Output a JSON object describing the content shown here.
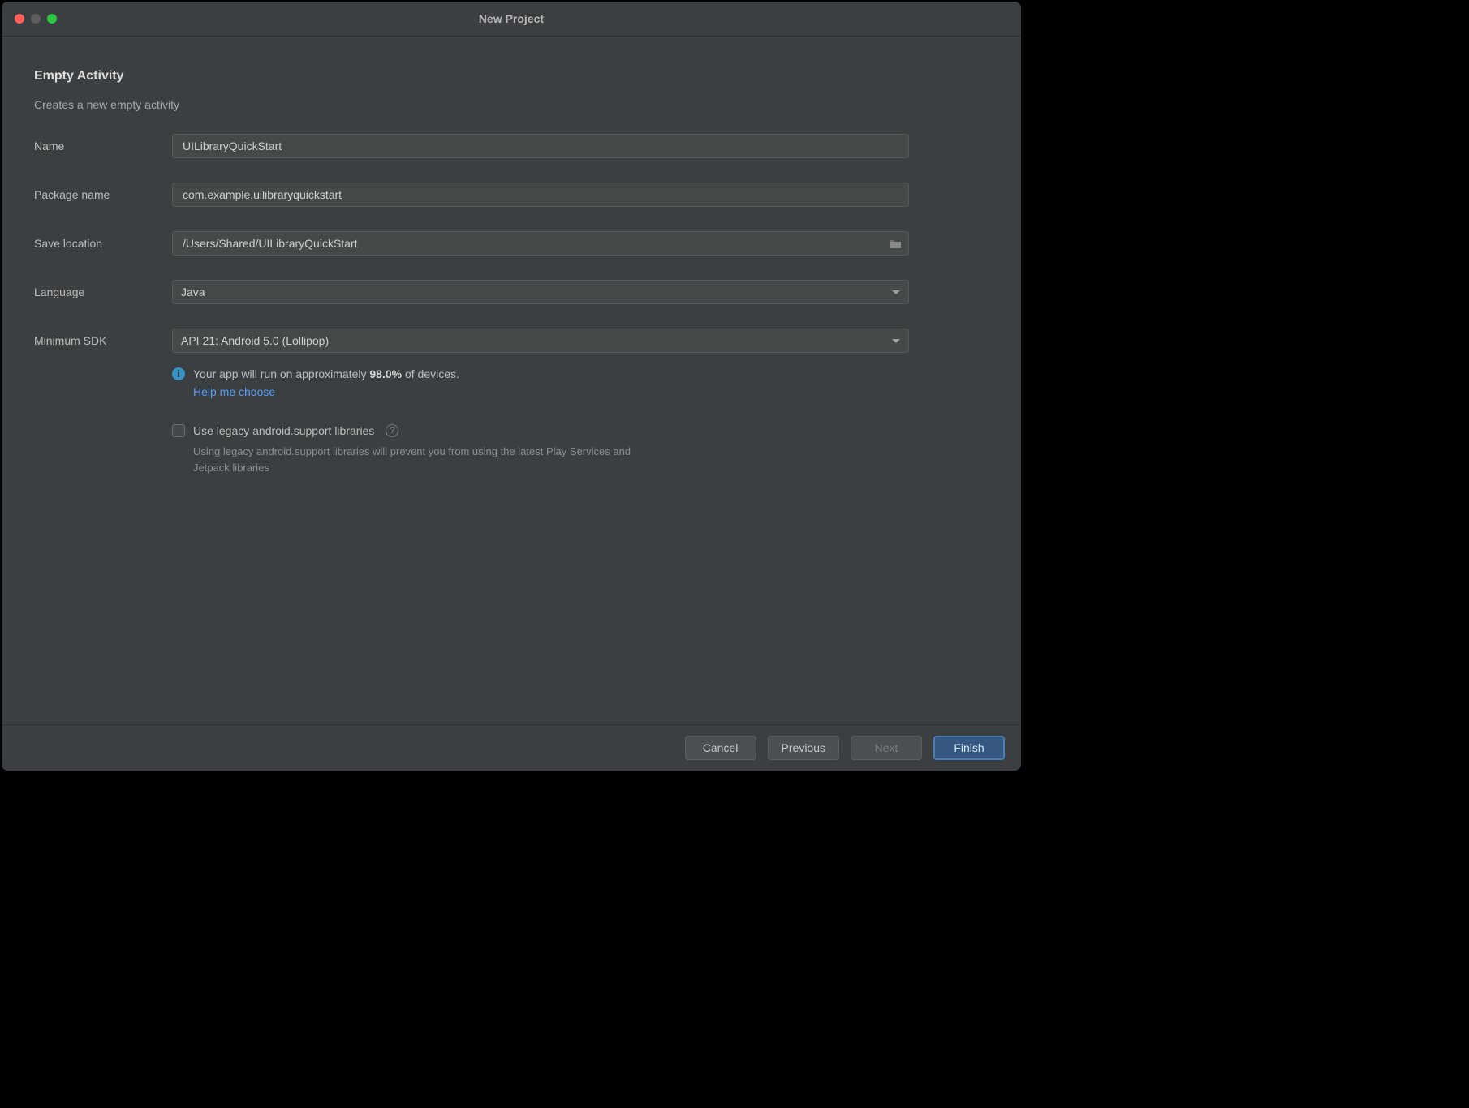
{
  "window": {
    "title": "New Project"
  },
  "header": {
    "title": "Empty Activity",
    "subtitle": "Creates a new empty activity"
  },
  "form": {
    "name": {
      "label": "Name",
      "value": "UILibraryQuickStart"
    },
    "package": {
      "label": "Package name",
      "value": "com.example.uilibraryquickstart"
    },
    "save_location": {
      "label": "Save location",
      "value": "/Users/Shared/UILibraryQuickStart"
    },
    "language": {
      "label": "Language",
      "selected": "Java"
    },
    "min_sdk": {
      "label": "Minimum SDK",
      "selected": "API 21: Android 5.0 (Lollipop)"
    }
  },
  "info": {
    "prefix": "Your app will run on approximately ",
    "percent": "98.0%",
    "suffix": " of devices.",
    "help_link": "Help me choose"
  },
  "legacy": {
    "label": "Use legacy android.support libraries",
    "desc": "Using legacy android.support libraries will prevent you from using the latest Play Services and Jetpack libraries"
  },
  "footer": {
    "cancel": "Cancel",
    "previous": "Previous",
    "next": "Next",
    "finish": "Finish"
  }
}
